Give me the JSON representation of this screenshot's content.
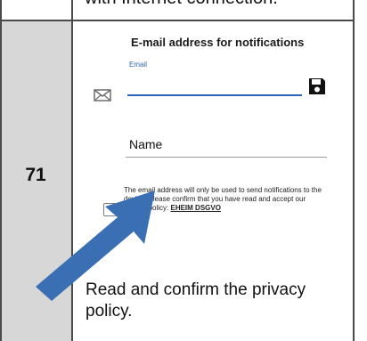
{
  "manual": {
    "top_cut_text": "with Internet connection.",
    "step_number": "71",
    "instruction": "Read and confirm the privacy policy."
  },
  "screen": {
    "title": "E-mail address for notifications",
    "email_label": "Email",
    "name_label": "Name",
    "policy_text": "The email address will only be used to send notifications to the device. Please confirm that you have read and accept our privacy policy:",
    "policy_link": "EHEIM DSGVO",
    "checkbox_checked": false,
    "icons": {
      "mail": "envelope-icon",
      "save": "floppy-disk-icon",
      "arrow": "blue-pointer-arrow"
    },
    "colors": {
      "accent": "#2a63b8",
      "arrow": "#3a6fb4",
      "number_column": "#d7d7d7"
    }
  }
}
